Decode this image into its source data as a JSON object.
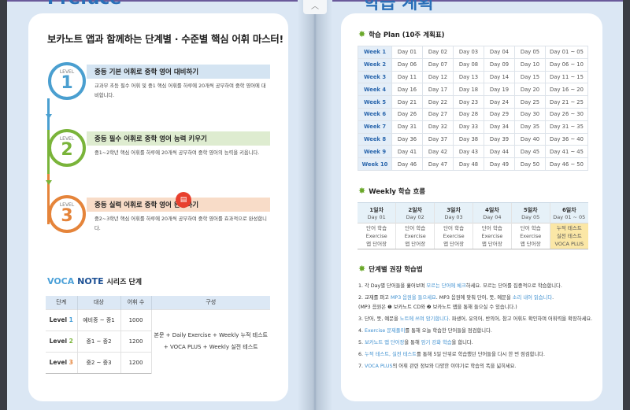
{
  "left_page": {
    "page_heading": "Preface",
    "title": "보카노트 앱과 함께하는 단계별 · 수준별 핵심 어휘 마스터!",
    "levels": [
      {
        "label": "LEVEL",
        "num": "1",
        "heading": "중등 기본 어휘로 중학 영어 대비하기",
        "desc": "교과부 초등 필수 어휘 및 중1 핵심 어휘를 하루에 20개씩 공부하여 중학 영어에 대비합니다.",
        "color": "#4a9fd0"
      },
      {
        "label": "LEVEL",
        "num": "2",
        "heading": "중등 필수 어휘로 중학 영어 능력 키우기",
        "desc": "중1~2학년 핵심 어휘를 하루에 20개씩 공부하여 중학 영어의 능력을 키웁니다.",
        "color": "#7ab43a"
      },
      {
        "label": "LEVEL",
        "num": "3",
        "heading": "중등 실력 어휘로 중학 영어 완성하기",
        "desc": "중2~3학년 핵심 어휘를 하루에 20개씩 공부하여 중학 영어를 효과적으로 완성합니다.",
        "color": "#e5843a"
      }
    ],
    "series": {
      "title_a": "VOCA",
      "title_b": "NOTE",
      "title_c": "시리즈 단계",
      "headers": [
        "단계",
        "대상",
        "어휘 수",
        "구성"
      ],
      "rows": [
        {
          "lvl": "Level",
          "n": "1",
          "target": "예비중 ~ 중1",
          "count": "1000"
        },
        {
          "lvl": "Level",
          "n": "2",
          "target": "중1 ~ 중2",
          "count": "1200"
        },
        {
          "lvl": "Level",
          "n": "3",
          "target": "중2 ~ 중3",
          "count": "1200"
        }
      ],
      "composition_1": "본문 + Daily Exercise + Weekly 누적 테스트",
      "composition_2": "+ VOCA PLUS + Weekly 실전 테스트"
    }
  },
  "right_page": {
    "page_heading": "학습 계획",
    "plan_title": "학습 Plan (10주 계획표)",
    "plan_rows": [
      [
        "Week 1",
        "Day 01",
        "Day 02",
        "Day 03",
        "Day 04",
        "Day 05",
        "Day 01 ~ 05"
      ],
      [
        "Week 2",
        "Day 06",
        "Day 07",
        "Day 08",
        "Day 09",
        "Day 10",
        "Day 06 ~ 10"
      ],
      [
        "Week 3",
        "Day 11",
        "Day 12",
        "Day 13",
        "Day 14",
        "Day 15",
        "Day 11 ~ 15"
      ],
      [
        "Week 4",
        "Day 16",
        "Day 17",
        "Day 18",
        "Day 19",
        "Day 20",
        "Day 16 ~ 20"
      ],
      [
        "Week 5",
        "Day 21",
        "Day 22",
        "Day 23",
        "Day 24",
        "Day 25",
        "Day 21 ~ 25"
      ],
      [
        "Week 6",
        "Day 26",
        "Day 27",
        "Day 28",
        "Day 29",
        "Day 30",
        "Day 26 ~ 30"
      ],
      [
        "Week 7",
        "Day 31",
        "Day 32",
        "Day 33",
        "Day 34",
        "Day 35",
        "Day 31 ~ 35"
      ],
      [
        "Week 8",
        "Day 36",
        "Day 37",
        "Day 38",
        "Day 39",
        "Day 40",
        "Day 36 ~ 40"
      ],
      [
        "Week 9",
        "Day 41",
        "Day 42",
        "Day 43",
        "Day 44",
        "Day 45",
        "Day 41 ~ 45"
      ],
      [
        "Week 10",
        "Day 46",
        "Day 47",
        "Day 48",
        "Day 49",
        "Day 50",
        "Day 46 ~ 50"
      ]
    ],
    "weekly_title": "Weekly 학습 흐름",
    "weekly": [
      {
        "d": "1일차",
        "day": "Day 01",
        "l1": "단어 학습",
        "l2": "Exercise",
        "l3": "앱 단어장"
      },
      {
        "d": "2일차",
        "day": "Day 02",
        "l1": "단어 학습",
        "l2": "Exercise",
        "l3": "앱 단어장"
      },
      {
        "d": "3일차",
        "day": "Day 03",
        "l1": "단어 학습",
        "l2": "Exercise",
        "l3": "앱 단어장"
      },
      {
        "d": "4일차",
        "day": "Day 04",
        "l1": "단어 학습",
        "l2": "Exercise",
        "l3": "앱 단어장"
      },
      {
        "d": "5일차",
        "day": "Day 05",
        "l1": "단어 학습",
        "l2": "Exercise",
        "l3": "앱 단어장"
      },
      {
        "d": "6일차",
        "day": "Day 01 ~ 05",
        "l1": "누적 테스트",
        "l2": "실전 테스트",
        "l3": "VOCA PLUS"
      }
    ],
    "method_title": "단계별 권장 학습법",
    "methods": [
      [
        [
          "1. 각 Day별 단어들을 훑어보며 ",
          0
        ],
        [
          "모르는 단어에 체크",
          1
        ],
        [
          "하세요. 모르는 단어를 집중적으로 학습합니다.",
          0
        ]
      ],
      [
        [
          "2. 교재를 펴고 ",
          0
        ],
        [
          "MP3 음원을 들으세요",
          1
        ],
        [
          ". MP3 음원에 맞춰 단어, 뜻, 예문을 ",
          0
        ],
        [
          "소리 내어 읽습니다",
          1
        ],
        [
          ".",
          0
        ]
      ],
      [
        [
          "   (MP3 음원은 ❶ 보카노트 CD와 ❷ 보카노트 앱을 통해 들으실 수 있습니다.)",
          0
        ]
      ],
      [
        [
          "3. 단어, 뜻, 예문을 ",
          0
        ],
        [
          "노트에 쓰며 암기합니다",
          1
        ],
        [
          ". 파생어, 유의어, 반의어, 참고 어휘도 확인하며 어휘력을 확장하세요.",
          0
        ]
      ],
      [
        [
          "4. ",
          0
        ],
        [
          "Exercise 문제풀이",
          1
        ],
        [
          "를 통해 오늘 학습한 단어들을 점검합니다.",
          0
        ]
      ],
      [
        [
          "5. ",
          0
        ],
        [
          "보카노트 앱 단어장",
          1
        ],
        [
          "을 통해 ",
          0
        ],
        [
          "암기 강화 학습",
          1
        ],
        [
          "을 합니다.",
          0
        ]
      ],
      [
        [
          "6. ",
          0
        ],
        [
          "누적 테스트, 실전 테스트",
          1
        ],
        [
          "를 통해 5일 단위로 학습했던 단어들을 다시 한 번 점검합니다.",
          0
        ]
      ],
      [
        [
          "7. ",
          0
        ],
        [
          "VOCA PLUS",
          1
        ],
        [
          "의 어휘 관련 정보와 다양한 이야기로 학습의 폭을 넓히세요.",
          0
        ]
      ]
    ]
  },
  "viewer": {
    "scroll_up": "︿"
  }
}
